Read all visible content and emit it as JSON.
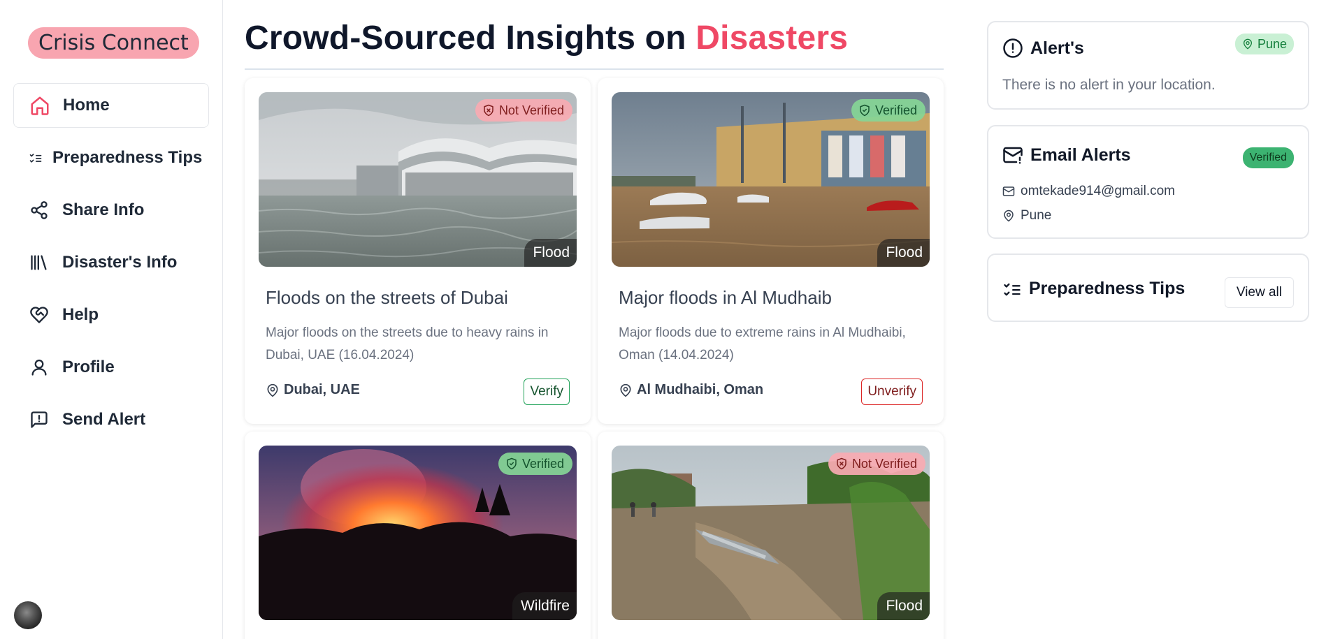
{
  "app": {
    "brand": "Crisis Connect"
  },
  "sidebar": {
    "items": [
      {
        "label": "Home",
        "icon": "home-icon",
        "active": true
      },
      {
        "label": "Preparedness Tips",
        "icon": "list-checks-icon"
      },
      {
        "label": "Share Info",
        "icon": "share-icon"
      },
      {
        "label": "Disaster's Info",
        "icon": "library-icon"
      },
      {
        "label": "Help",
        "icon": "heart-handshake-icon"
      },
      {
        "label": "Profile",
        "icon": "user-icon"
      },
      {
        "label": "Send Alert",
        "icon": "message-alert-icon"
      }
    ]
  },
  "main": {
    "title_prefix": "Crowd-Sourced Insights on ",
    "title_accent": "Disasters",
    "cards": [
      {
        "status": "Not Verified",
        "category": "Flood",
        "title": "Floods on the streets of Dubai",
        "description": "Major floods on the streets due to heavy rains in Dubai, UAE (16.04.2024)",
        "location": "Dubai, UAE",
        "action": "Verify"
      },
      {
        "status": "Verified",
        "category": "Flood",
        "title": "Major floods in Al Mudhaib",
        "description": "Major floods due to extreme rains in Al Mudhaibi, Oman (14.04.2024)",
        "location": "Al Mudhaibi, Oman",
        "action": "Unverify"
      },
      {
        "status": "Verified",
        "category": "Wildfire"
      },
      {
        "status": "Not Verified",
        "category": "Flood"
      }
    ]
  },
  "right": {
    "alerts": {
      "title": "Alert's",
      "location": "Pune",
      "message": "There is no alert in your location."
    },
    "email_alerts": {
      "title": "Email Alerts",
      "badge": "Verified",
      "email": "omtekade914@gmail.com",
      "location": "Pune"
    },
    "tips": {
      "title": "Preparedness Tips",
      "view_all": "View all"
    }
  },
  "colors": {
    "accent": "#ef4865",
    "brand_pill": "#f8a5b0",
    "verified": "#3cb371",
    "not_verified": "#f8aab2"
  }
}
